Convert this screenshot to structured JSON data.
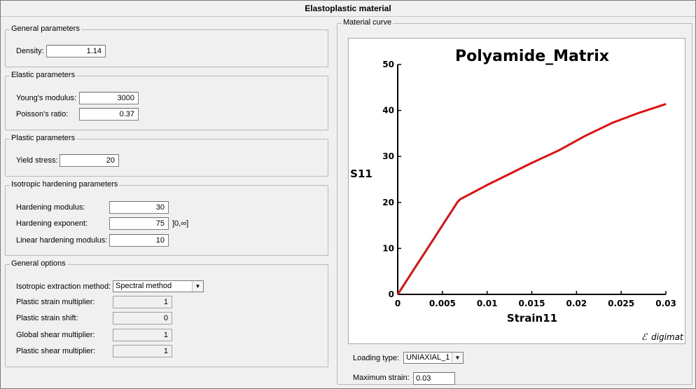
{
  "window": {
    "title": "Elastoplastic material"
  },
  "general_parameters": {
    "label": "General parameters",
    "density_label": "Density:",
    "density_value": "1.14"
  },
  "elastic_parameters": {
    "label": "Elastic parameters",
    "youngs_label": "Young's modulus:",
    "youngs_value": "3000",
    "poisson_label": "Poisson's ratio:",
    "poisson_value": "0.37"
  },
  "plastic_parameters": {
    "label": "Plastic parameters",
    "yield_label": "Yield stress:",
    "yield_value": "20"
  },
  "isotropic_hardening": {
    "label": "Isotropic hardening parameters",
    "modulus_label": "Hardening modulus:",
    "modulus_value": "30",
    "exponent_label": "Hardening exponent:",
    "exponent_value": "75",
    "exponent_range": "]0,∞]",
    "linear_label": "Linear hardening modulus:",
    "linear_value": "10"
  },
  "general_options": {
    "label": "General options",
    "extraction_label": "Isotropic extraction method:",
    "extraction_value": "Spectral method",
    "strain_mult_label": "Plastic strain multiplier:",
    "strain_mult_value": "1",
    "strain_shift_label": "Plastic strain shift:",
    "strain_shift_value": "0",
    "global_shear_label": "Global shear multiplier:",
    "global_shear_value": "1",
    "plastic_shear_label": "Plastic shear multiplier:",
    "plastic_shear_value": "1"
  },
  "material_curve": {
    "label": "Material curve",
    "loading_type_label": "Loading type:",
    "loading_type_value": "UNIAXIAL_1",
    "max_strain_label": "Maximum strain:",
    "max_strain_value": "0.03",
    "logo_text": "digimat"
  },
  "chart_data": {
    "type": "line",
    "title": "Polyamide_Matrix",
    "xlabel": "Strain11",
    "ylabel": "S11",
    "xlim": [
      0,
      0.03
    ],
    "ylim": [
      0,
      50
    ],
    "xticks": [
      "0",
      "0.005",
      "0.01",
      "0.015",
      "0.02",
      "0.025",
      "0.03"
    ],
    "yticks": [
      "0",
      "10",
      "20",
      "30",
      "40",
      "50"
    ],
    "grid": false,
    "series": [
      {
        "color": "#e01010",
        "x": [
          0,
          0.001,
          0.002,
          0.003,
          0.004,
          0.005,
          0.006,
          0.0067,
          0.007,
          0.008,
          0.01,
          0.012,
          0.015,
          0.018,
          0.021,
          0.024,
          0.027,
          0.03
        ],
        "y": [
          0,
          3,
          6,
          9,
          12,
          15,
          18,
          20.1,
          20.7,
          21.7,
          23.8,
          25.7,
          28.6,
          31.3,
          34.5,
          37.3,
          39.5,
          41.4
        ]
      }
    ]
  }
}
